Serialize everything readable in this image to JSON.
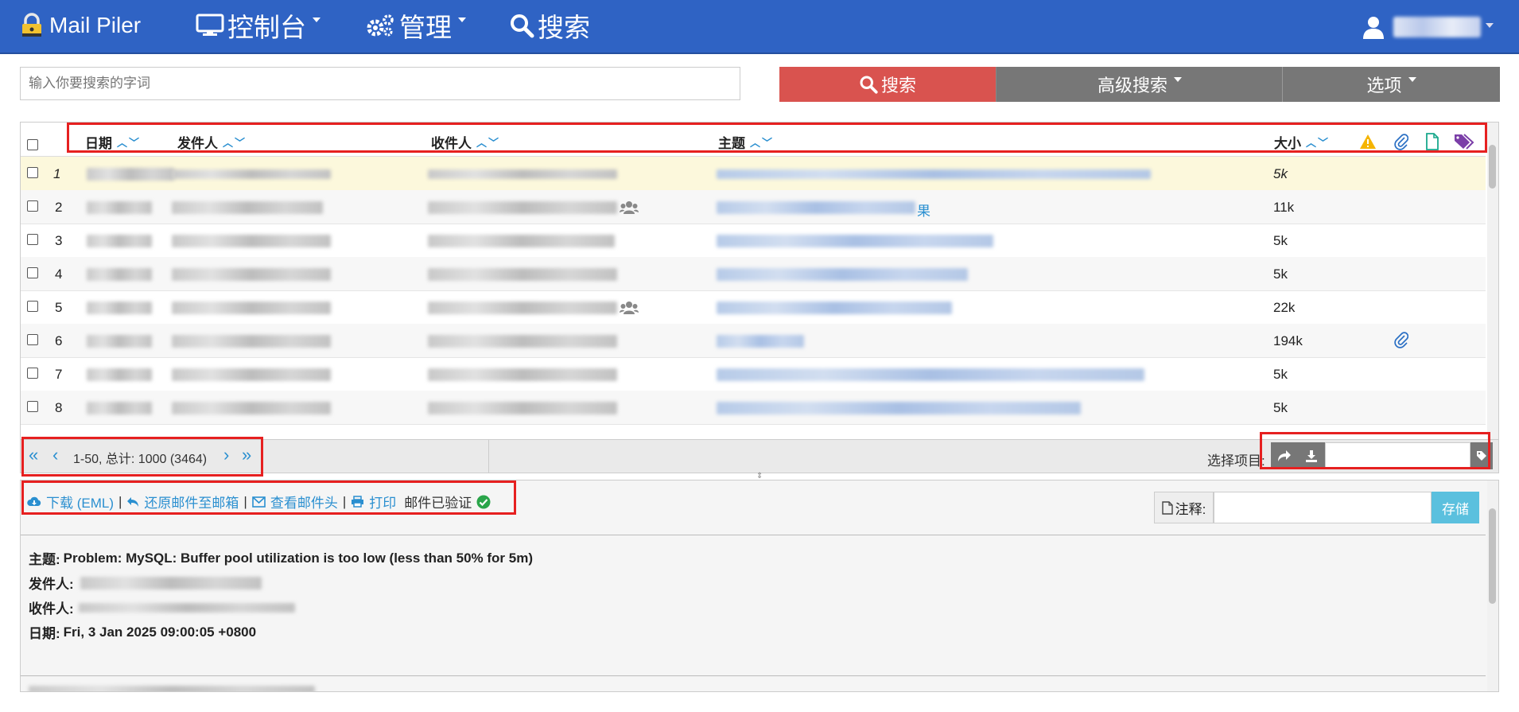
{
  "navbar": {
    "brand": "Mail Piler",
    "console": "控制台",
    "admin": "管理",
    "search": "搜索"
  },
  "search": {
    "placeholder": "输入你要搜索的字词",
    "search_button": "搜索",
    "advanced_button": "高级搜索",
    "options_button": "选项"
  },
  "table": {
    "columns": {
      "date": "日期",
      "from": "发件人",
      "to": "收件人",
      "subject": "主题",
      "size": "大小"
    },
    "rows": [
      {
        "num": "1",
        "subject_suffix": "",
        "size": "5k",
        "attachment": false,
        "group": false
      },
      {
        "num": "2",
        "subject_suffix": "果",
        "size": "11k",
        "attachment": false,
        "group": true
      },
      {
        "num": "3",
        "subject_suffix": "",
        "size": "5k",
        "attachment": false,
        "group": false
      },
      {
        "num": "4",
        "subject_suffix": "",
        "size": "5k",
        "attachment": false,
        "group": false
      },
      {
        "num": "5",
        "subject_suffix": "",
        "size": "22k",
        "attachment": false,
        "group": true
      },
      {
        "num": "6",
        "subject_suffix": "",
        "size": "194k",
        "attachment": true,
        "group": false
      },
      {
        "num": "7",
        "subject_suffix": "",
        "size": "5k",
        "attachment": false,
        "group": false
      },
      {
        "num": "8",
        "subject_suffix": "",
        "size": "5k",
        "attachment": false,
        "group": false
      }
    ]
  },
  "pager": {
    "text": "1-50, 总计: 1000 (3464)",
    "first": "«",
    "prev": "‹",
    "next": "›",
    "last": "»",
    "select_label": "选择项目:"
  },
  "preview": {
    "download": "下载 (EML)",
    "restore": "还原邮件至邮箱",
    "view_headers": "查看邮件头",
    "print": "打印",
    "verified": "邮件已验证",
    "note_label": "注释:",
    "save_button": "存储",
    "subject_label": "主题:",
    "subject_value": "Problem: MySQL: Buffer pool utilization is too low (less than 50% for 5m)",
    "from_label": "发件人:",
    "to_label": "收件人:",
    "date_label": "日期:",
    "date_value": "Fri, 3 Jan 2025 09:00:05 +0800"
  },
  "colors": {
    "navbar": "#2f63c4",
    "search_button": "#d9534f",
    "gray_button": "#777777",
    "link": "#2a8fd0",
    "save_button": "#5bc0de",
    "annotation": "#e62020"
  }
}
